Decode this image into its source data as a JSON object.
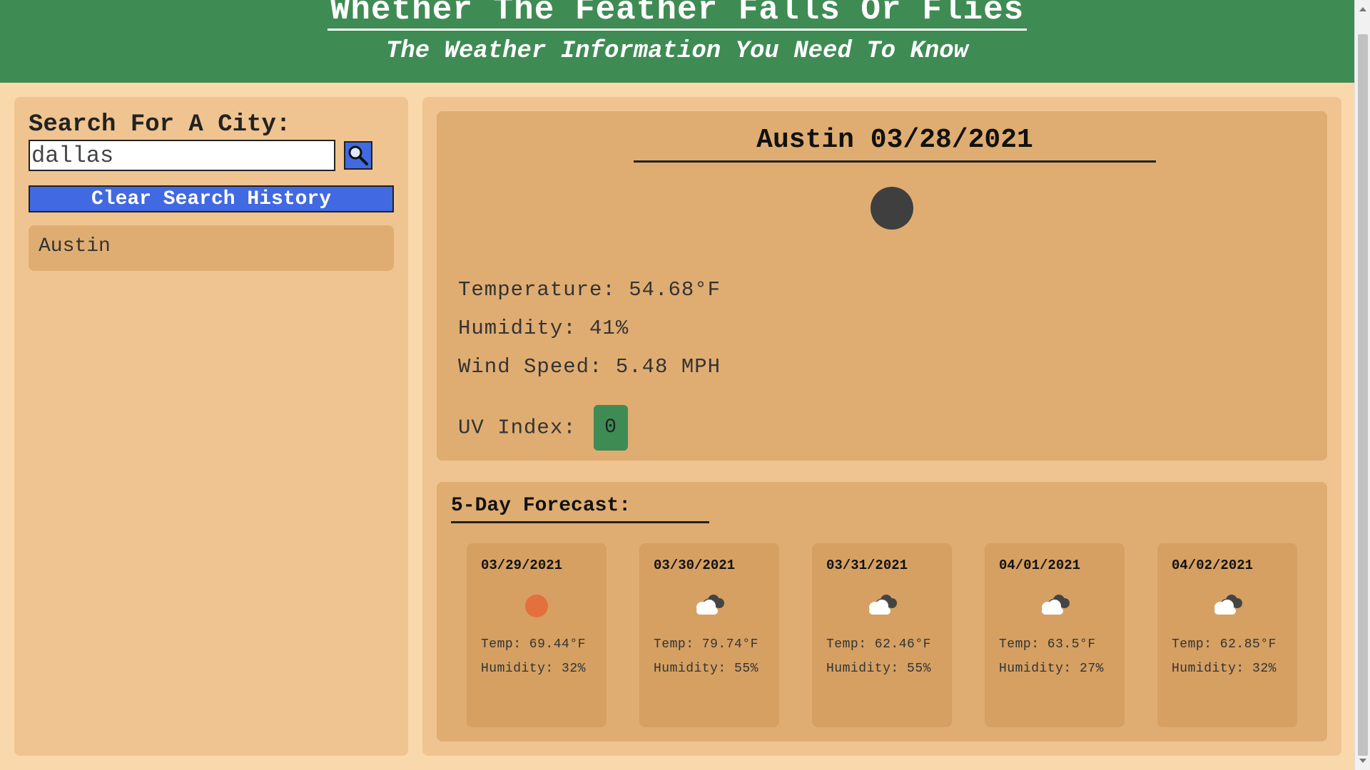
{
  "header": {
    "title": "Whether The Feather Falls Or Flies",
    "subtitle": "The Weather Information You Need To Know"
  },
  "sidebar": {
    "search_label": "Search For A City:",
    "search_value": "dallas",
    "search_icon": "magnifier-icon",
    "clear_label": "Clear Search History",
    "history": [
      "Austin"
    ]
  },
  "current": {
    "title": "Austin 03/28/2021",
    "icon": "moon-icon",
    "temperature": "Temperature: 54.68°F",
    "humidity": "Humidity: 41%",
    "wind": "Wind Speed: 5.48 MPH",
    "uv_label": "UV Index:",
    "uv_value": "0",
    "uv_color": "#3f8b54"
  },
  "forecast": {
    "title": "5-Day Forecast:",
    "days": [
      {
        "date": "03/29/2021",
        "icon": "sun-icon",
        "temp": "Temp: 69.44°F",
        "humidity": "Humidity: 32%"
      },
      {
        "date": "03/30/2021",
        "icon": "cloud-icon",
        "temp": "Temp: 79.74°F",
        "humidity": "Humidity: 55%"
      },
      {
        "date": "03/31/2021",
        "icon": "cloud-icon",
        "temp": "Temp: 62.46°F",
        "humidity": "Humidity: 55%"
      },
      {
        "date": "04/01/2021",
        "icon": "cloud-icon",
        "temp": "Temp: 63.5°F",
        "humidity": "Humidity: 27%"
      },
      {
        "date": "04/02/2021",
        "icon": "cloud-icon",
        "temp": "Temp: 62.85°F",
        "humidity": "Humidity: 32%"
      }
    ]
  },
  "colors": {
    "header_bg": "#3f8b54",
    "page_bg": "#f9d8ab",
    "button_blue": "#4169e1",
    "sun": "#e4703e"
  }
}
